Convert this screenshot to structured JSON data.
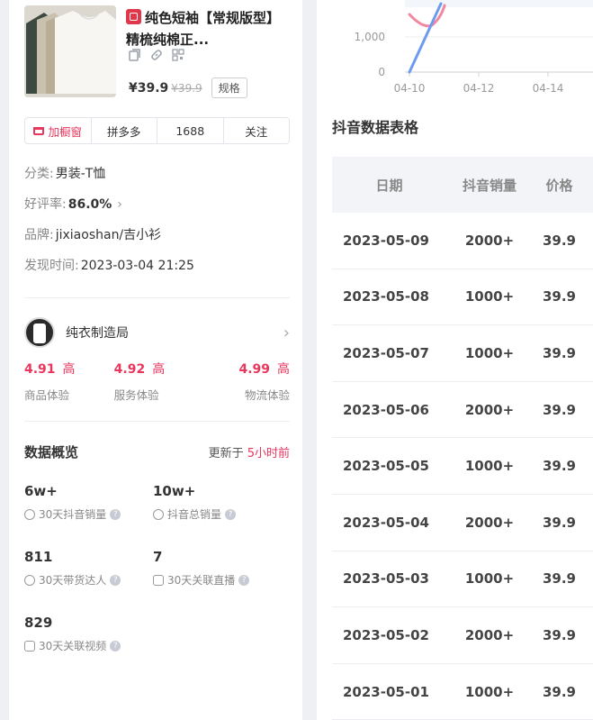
{
  "product": {
    "title": "纯色短袖【常规版型】精梳纯棉正...",
    "price": "¥39.9",
    "original_price": "¥39.9",
    "spec_label": "规格",
    "icons": [
      "copy-icon",
      "link-icon",
      "qr-icon"
    ]
  },
  "actions": {
    "add_cart": "加橱窗",
    "pdd": "拼多多",
    "ali1688": "1688",
    "follow": "关注"
  },
  "meta": {
    "category_label": "分类:",
    "category_value": "男装-T恤",
    "rating_label": "好评率:",
    "rating_value": "86.0%",
    "brand_label": "品牌:",
    "brand_value": "jixiaoshan/吉小衫",
    "found_label": "发现时间:",
    "found_value": "2023-03-04 21:25"
  },
  "shop": {
    "name": "纯衣制造局",
    "scores": [
      {
        "value": "4.91",
        "level": "高",
        "label": "商品体验"
      },
      {
        "value": "4.92",
        "level": "高",
        "label": "服务体验"
      },
      {
        "value": "4.99",
        "level": "高",
        "label": "物流体验"
      }
    ]
  },
  "overview": {
    "title": "数据概览",
    "updated_prefix": "更新于",
    "updated_value": "5小时前",
    "stats": [
      {
        "value": "6w+",
        "label": "30天抖音销量"
      },
      {
        "value": "10w+",
        "label": "抖音总销量"
      },
      {
        "value": "811",
        "label": "30天带货达人"
      },
      {
        "value": "7",
        "label": "30天关联直播"
      },
      {
        "value": "829",
        "label": "30天关联视频"
      }
    ]
  },
  "chart_data": {
    "type": "line",
    "x": [
      "04-10",
      "04-12",
      "04-14"
    ],
    "y_ticks": [
      "0",
      "1,000"
    ],
    "series": [
      {
        "color": "#6b9cf0",
        "values": [
          0,
          1500
        ]
      },
      {
        "color": "#f2879f",
        "values": [
          1300,
          1150,
          1500
        ]
      }
    ]
  },
  "table": {
    "title": "抖音数据表格",
    "headers": [
      "日期",
      "抖音销量",
      "价格"
    ],
    "rows": [
      [
        "2023-05-09",
        "2000+",
        "39.9"
      ],
      [
        "2023-05-08",
        "1000+",
        "39.9"
      ],
      [
        "2023-05-07",
        "1000+",
        "39.9"
      ],
      [
        "2023-05-06",
        "2000+",
        "39.9"
      ],
      [
        "2023-05-05",
        "1000+",
        "39.9"
      ],
      [
        "2023-05-04",
        "2000+",
        "39.9"
      ],
      [
        "2023-05-03",
        "1000+",
        "39.9"
      ],
      [
        "2023-05-02",
        "2000+",
        "39.9"
      ],
      [
        "2023-05-01",
        "1000+",
        "39.9"
      ]
    ]
  }
}
